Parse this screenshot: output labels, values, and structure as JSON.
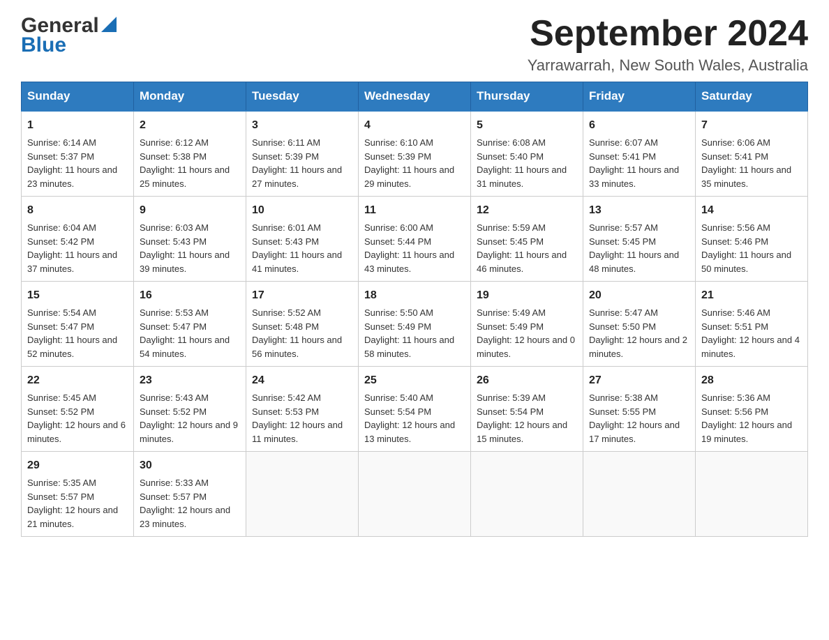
{
  "header": {
    "logo_general": "General",
    "logo_blue": "Blue",
    "month_title": "September 2024",
    "subtitle": "Yarrawarrah, New South Wales, Australia"
  },
  "weekdays": [
    "Sunday",
    "Monday",
    "Tuesday",
    "Wednesday",
    "Thursday",
    "Friday",
    "Saturday"
  ],
  "weeks": [
    [
      {
        "day": "1",
        "sunrise": "6:14 AM",
        "sunset": "5:37 PM",
        "daylight": "11 hours and 23 minutes."
      },
      {
        "day": "2",
        "sunrise": "6:12 AM",
        "sunset": "5:38 PM",
        "daylight": "11 hours and 25 minutes."
      },
      {
        "day": "3",
        "sunrise": "6:11 AM",
        "sunset": "5:39 PM",
        "daylight": "11 hours and 27 minutes."
      },
      {
        "day": "4",
        "sunrise": "6:10 AM",
        "sunset": "5:39 PM",
        "daylight": "11 hours and 29 minutes."
      },
      {
        "day": "5",
        "sunrise": "6:08 AM",
        "sunset": "5:40 PM",
        "daylight": "11 hours and 31 minutes."
      },
      {
        "day": "6",
        "sunrise": "6:07 AM",
        "sunset": "5:41 PM",
        "daylight": "11 hours and 33 minutes."
      },
      {
        "day": "7",
        "sunrise": "6:06 AM",
        "sunset": "5:41 PM",
        "daylight": "11 hours and 35 minutes."
      }
    ],
    [
      {
        "day": "8",
        "sunrise": "6:04 AM",
        "sunset": "5:42 PM",
        "daylight": "11 hours and 37 minutes."
      },
      {
        "day": "9",
        "sunrise": "6:03 AM",
        "sunset": "5:43 PM",
        "daylight": "11 hours and 39 minutes."
      },
      {
        "day": "10",
        "sunrise": "6:01 AM",
        "sunset": "5:43 PM",
        "daylight": "11 hours and 41 minutes."
      },
      {
        "day": "11",
        "sunrise": "6:00 AM",
        "sunset": "5:44 PM",
        "daylight": "11 hours and 43 minutes."
      },
      {
        "day": "12",
        "sunrise": "5:59 AM",
        "sunset": "5:45 PM",
        "daylight": "11 hours and 46 minutes."
      },
      {
        "day": "13",
        "sunrise": "5:57 AM",
        "sunset": "5:45 PM",
        "daylight": "11 hours and 48 minutes."
      },
      {
        "day": "14",
        "sunrise": "5:56 AM",
        "sunset": "5:46 PM",
        "daylight": "11 hours and 50 minutes."
      }
    ],
    [
      {
        "day": "15",
        "sunrise": "5:54 AM",
        "sunset": "5:47 PM",
        "daylight": "11 hours and 52 minutes."
      },
      {
        "day": "16",
        "sunrise": "5:53 AM",
        "sunset": "5:47 PM",
        "daylight": "11 hours and 54 minutes."
      },
      {
        "day": "17",
        "sunrise": "5:52 AM",
        "sunset": "5:48 PM",
        "daylight": "11 hours and 56 minutes."
      },
      {
        "day": "18",
        "sunrise": "5:50 AM",
        "sunset": "5:49 PM",
        "daylight": "11 hours and 58 minutes."
      },
      {
        "day": "19",
        "sunrise": "5:49 AM",
        "sunset": "5:49 PM",
        "daylight": "12 hours and 0 minutes."
      },
      {
        "day": "20",
        "sunrise": "5:47 AM",
        "sunset": "5:50 PM",
        "daylight": "12 hours and 2 minutes."
      },
      {
        "day": "21",
        "sunrise": "5:46 AM",
        "sunset": "5:51 PM",
        "daylight": "12 hours and 4 minutes."
      }
    ],
    [
      {
        "day": "22",
        "sunrise": "5:45 AM",
        "sunset": "5:52 PM",
        "daylight": "12 hours and 6 minutes."
      },
      {
        "day": "23",
        "sunrise": "5:43 AM",
        "sunset": "5:52 PM",
        "daylight": "12 hours and 9 minutes."
      },
      {
        "day": "24",
        "sunrise": "5:42 AM",
        "sunset": "5:53 PM",
        "daylight": "12 hours and 11 minutes."
      },
      {
        "day": "25",
        "sunrise": "5:40 AM",
        "sunset": "5:54 PM",
        "daylight": "12 hours and 13 minutes."
      },
      {
        "day": "26",
        "sunrise": "5:39 AM",
        "sunset": "5:54 PM",
        "daylight": "12 hours and 15 minutes."
      },
      {
        "day": "27",
        "sunrise": "5:38 AM",
        "sunset": "5:55 PM",
        "daylight": "12 hours and 17 minutes."
      },
      {
        "day": "28",
        "sunrise": "5:36 AM",
        "sunset": "5:56 PM",
        "daylight": "12 hours and 19 minutes."
      }
    ],
    [
      {
        "day": "29",
        "sunrise": "5:35 AM",
        "sunset": "5:57 PM",
        "daylight": "12 hours and 21 minutes."
      },
      {
        "day": "30",
        "sunrise": "5:33 AM",
        "sunset": "5:57 PM",
        "daylight": "12 hours and 23 minutes."
      },
      null,
      null,
      null,
      null,
      null
    ]
  ],
  "labels": {
    "sunrise": "Sunrise:",
    "sunset": "Sunset:",
    "daylight": "Daylight:"
  }
}
